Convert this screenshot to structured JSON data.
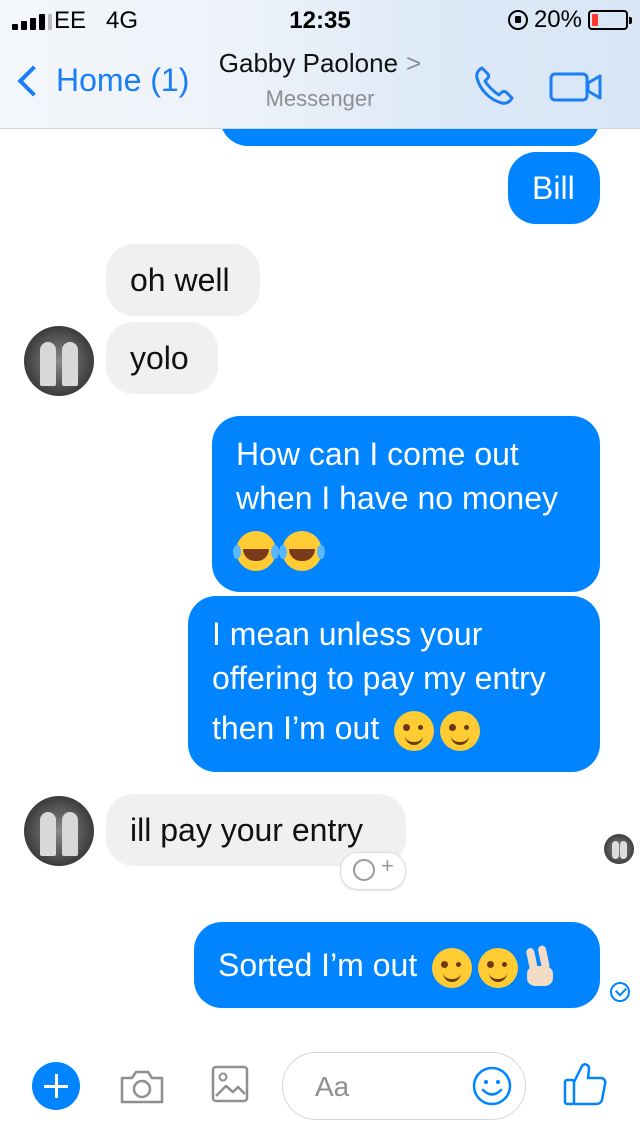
{
  "status_bar": {
    "carrier": "EE",
    "network": "4G",
    "time": "12:35",
    "battery_percent": "20%",
    "battery_level": 0.2
  },
  "header": {
    "back_label": "Home (1)",
    "contact_name": "Gabby Paolone",
    "subtitle": "Messenger",
    "name_arrow": ">"
  },
  "messages": [
    {
      "direction": "outgoing",
      "text": "Bill"
    },
    {
      "direction": "incoming",
      "text": "oh well"
    },
    {
      "direction": "incoming",
      "text": "yolo"
    },
    {
      "direction": "outgoing",
      "lines": [
        "How can I come out",
        "when I have no money"
      ],
      "emoji": [
        "face-with-tears-of-joy",
        "face-with-tears-of-joy"
      ]
    },
    {
      "direction": "outgoing",
      "lines": [
        "I mean unless your",
        "offering to pay my entry",
        "then I’m out"
      ],
      "emoji": [
        "winking-face",
        "winking-face"
      ]
    },
    {
      "direction": "incoming",
      "text": "ill pay your entry"
    },
    {
      "direction": "outgoing",
      "text": "Sorted I’m out",
      "emoji": [
        "winking-face",
        "winking-face",
        "victory-hand"
      ]
    }
  ],
  "composer": {
    "placeholder": "Aa"
  },
  "colors": {
    "accent": "#0084ff",
    "incoming_bubble": "#f0f0f0",
    "back_link": "#1a7ef4"
  }
}
